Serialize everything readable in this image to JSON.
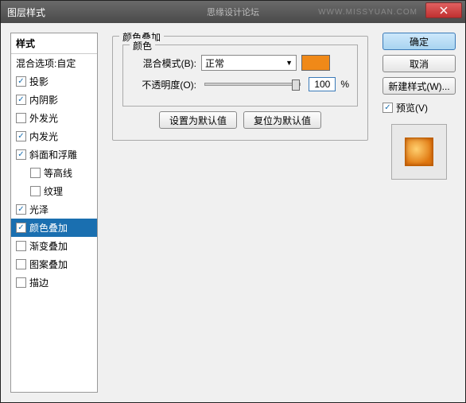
{
  "window": {
    "title": "图层样式",
    "centerText": "思缘设计论坛",
    "watermark": "WWW.MISSYUAN.COM"
  },
  "sidebar": {
    "header": "样式",
    "items": [
      {
        "label": "混合选项:自定",
        "checked": null
      },
      {
        "label": "投影",
        "checked": true
      },
      {
        "label": "内阴影",
        "checked": true
      },
      {
        "label": "外发光",
        "checked": false
      },
      {
        "label": "内发光",
        "checked": true
      },
      {
        "label": "斜面和浮雕",
        "checked": true
      },
      {
        "label": "等高线",
        "checked": false,
        "indent": true
      },
      {
        "label": "纹理",
        "checked": false,
        "indent": true
      },
      {
        "label": "光泽",
        "checked": true
      },
      {
        "label": "颜色叠加",
        "checked": true,
        "selected": true
      },
      {
        "label": "渐变叠加",
        "checked": false
      },
      {
        "label": "图案叠加",
        "checked": false
      },
      {
        "label": "描边",
        "checked": false
      }
    ]
  },
  "panel": {
    "title": "颜色叠加",
    "group": "颜色",
    "blendModeLabel": "混合模式(B):",
    "blendModeValue": "正常",
    "opacityLabel": "不透明度(O):",
    "opacityValue": "100",
    "opacityUnit": "%",
    "setDefault": "设置为默认值",
    "resetDefault": "复位为默认值",
    "colorSwatch": "#f08918"
  },
  "right": {
    "ok": "确定",
    "cancel": "取消",
    "newStyle": "新建样式(W)...",
    "preview": "预览(V)"
  }
}
